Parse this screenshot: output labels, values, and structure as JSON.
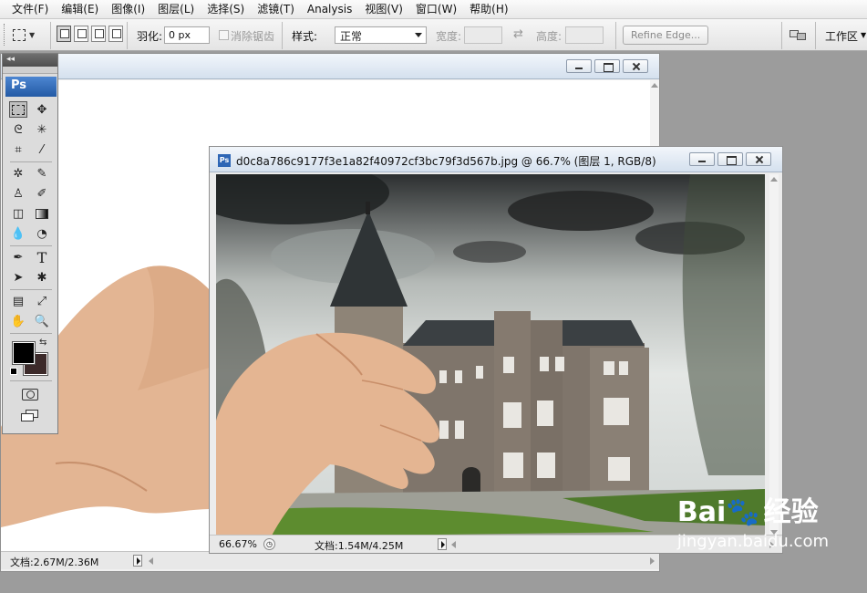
{
  "menu": {
    "items": [
      "文件(F)",
      "编辑(E)",
      "图像(I)",
      "图层(L)",
      "选择(S)",
      "滤镜(T)",
      "Analysis",
      "视图(V)",
      "窗口(W)",
      "帮助(H)"
    ]
  },
  "options": {
    "feather_label": "羽化:",
    "feather_value": "0 px",
    "antialias_label": "消除锯齿",
    "style_label": "样式:",
    "style_value": "正常",
    "width_label": "宽度:",
    "height_label": "高度:",
    "refine_edge": "Refine Edge...",
    "workspace": "工作区"
  },
  "tools_panel": {
    "logo": "Ps",
    "collapse_glyph": "◂◂"
  },
  "back_doc": {
    "status_text": "文档:2.67M/2.36M"
  },
  "front_doc": {
    "title": "d0c8a786c9177f3e1a82f40972cf3bc79f3d567b.jpg @ 66.7% (图层 1, RGB/8)",
    "title_icon": "Ps",
    "zoom": "66.67%",
    "status_text": "文档:1.54M/4.25M"
  },
  "watermark": {
    "brand": "Bai",
    "brand_suffix": "经验",
    "url": "jingyan.baidu.com"
  },
  "colors": {
    "foreground": "#000000",
    "background": "#3c2a2a",
    "ps_blue": "#2e66b5"
  }
}
